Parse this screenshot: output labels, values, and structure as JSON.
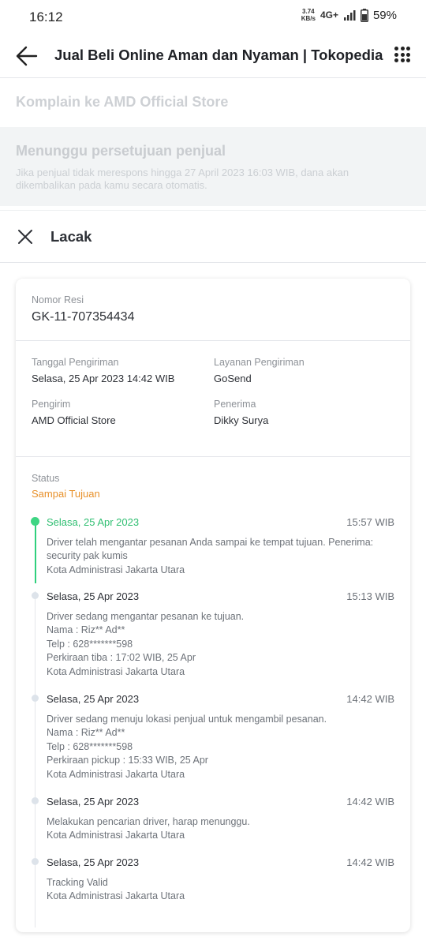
{
  "status_bar": {
    "time": "16:12",
    "net_speed_value": "3.74",
    "net_speed_unit": "KB/s",
    "network": "4G+",
    "battery": "59%"
  },
  "app_bar": {
    "title": "Jual Beli Online Aman dan Nyaman | Tokopedia",
    "icons": [
      "back-arrow-icon",
      "grid-menu-icon"
    ]
  },
  "background": {
    "complaint_title": "Komplain ke AMD Official Store",
    "banner_title": "Menunggu persetujuan penjual",
    "banner_desc": "Jika penjual tidak merespons hingga 27 April 2023 16:03 WIB, dana akan dikembalikan pada kamu secara otomatis."
  },
  "sheet": {
    "title": "Lacak",
    "close_icon": "close-icon"
  },
  "shipment": {
    "resi_label": "Nomor Resi",
    "resi_value": "GK-11-707354434",
    "date_label": "Tanggal Pengiriman",
    "date_value": "Selasa, 25 Apr 2023 14:42 WIB",
    "service_label": "Layanan Pengiriman",
    "service_value": "GoSend",
    "sender_label": "Pengirim",
    "sender_value": "AMD Official Store",
    "receiver_label": "Penerima",
    "receiver_value": "Dikky Surya",
    "status_label": "Status",
    "status_value": "Sampai Tujuan",
    "status_color": "#e8912b"
  },
  "timeline": [
    {
      "date": "Selasa, 25 Apr 2023",
      "time": "15:57 WIB",
      "lines": [
        "Driver telah mengantar pesanan Anda sampai ke tempat tujuan. Penerima:",
        "security pak kumis",
        "Kota Administrasi Jakarta Utara"
      ]
    },
    {
      "date": "Selasa, 25 Apr 2023",
      "time": "15:13 WIB",
      "lines": [
        "Driver sedang mengantar pesanan ke tujuan.",
        "Nama : Riz** Ad**",
        "Telp : 628*******598",
        "Perkiraan tiba : 17:02 WIB, 25 Apr",
        "Kota Administrasi Jakarta Utara"
      ]
    },
    {
      "date": "Selasa, 25 Apr 2023",
      "time": "14:42 WIB",
      "lines": [
        "Driver sedang menuju lokasi penjual untuk mengambil pesanan.",
        "Nama : Riz** Ad**",
        "Telp : 628*******598",
        "Perkiraan pickup : 15:33 WIB, 25 Apr",
        "Kota Administrasi Jakarta Utara"
      ]
    },
    {
      "date": "Selasa, 25 Apr 2023",
      "time": "14:42 WIB",
      "lines": [
        "Melakukan pencarian driver, harap menunggu.",
        "Kota Administrasi Jakarta Utara"
      ]
    },
    {
      "date": "Selasa, 25 Apr 2023",
      "time": "14:42 WIB",
      "lines": [
        "Tracking Valid",
        "Kota Administrasi Jakarta Utara"
      ]
    }
  ],
  "colors": {
    "accent_green": "#30bf72",
    "status_orange": "#e8912b"
  }
}
